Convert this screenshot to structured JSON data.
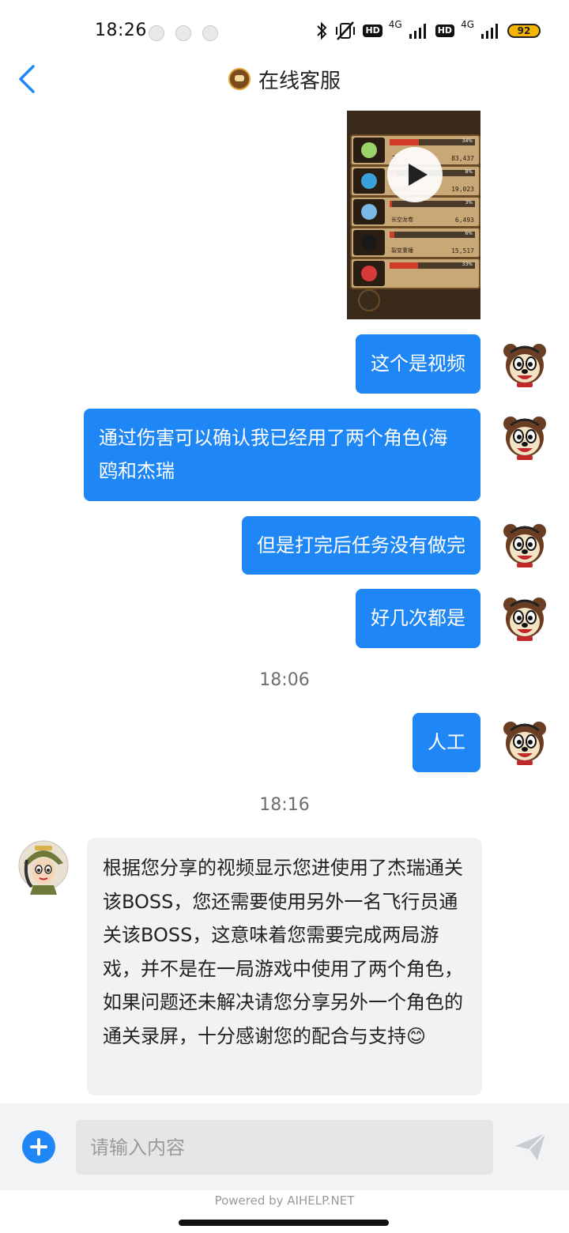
{
  "status_bar": {
    "time": "18:26",
    "network_1": "4G",
    "network_2": "4G",
    "hd_1": "HD",
    "hd_2": "HD",
    "battery": "92"
  },
  "header": {
    "title": "在线客服"
  },
  "video": {
    "rows": [
      {
        "name": "主",
        "value": "83,437",
        "pct": "34%",
        "fill": 0.34
      },
      {
        "name": "海鸥蛋",
        "value": "19,023",
        "pct": "8%",
        "fill": 0.08
      },
      {
        "name": "长空龙卷",
        "value": "6,493",
        "pct": "3%",
        "fill": 0.03
      },
      {
        "name": "裂变重锤",
        "value": "15,517",
        "pct": "6%",
        "fill": 0.06
      },
      {
        "name": "",
        "value": "",
        "pct": "33%",
        "fill": 0.33
      }
    ]
  },
  "messages": {
    "out_1": "这个是视频",
    "out_2": "通过伤害可以确认我已经用了两个角色(海鸥和杰瑞",
    "out_3": "但是打完后任务没有做完",
    "out_4": "好几次都是",
    "time_1": "18:06",
    "out_5": "人工",
    "time_2": "18:16",
    "in_1": "根据您分享的视频显示您进使用了杰瑞通关该BOSS，您还需要使用另外一名飞行员通关该BOSS，这意味着您需要完成两局游戏，并不是在一局游戏中使用了两个角色，如果问题还未解决请您分享另外一个角色的通关录屏，十分感谢您的配合与支持😊"
  },
  "input": {
    "placeholder": "请输入内容",
    "value": ""
  },
  "footer": {
    "powered": "Powered by AIHELP.NET"
  },
  "colors": {
    "accent": "#1f87f5",
    "bubble_in": "#f1f2f4"
  }
}
